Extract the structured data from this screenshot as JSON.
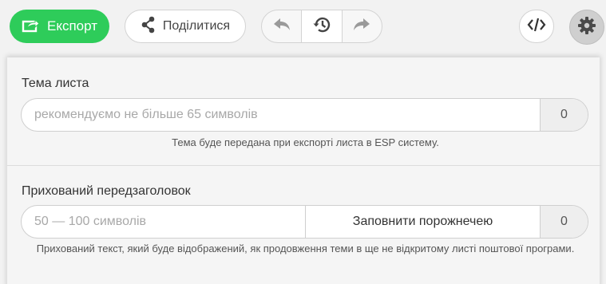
{
  "toolbar": {
    "export_label": "Експорт",
    "share_label": "Поділитися",
    "icons": {
      "export": "export-icon",
      "share": "share-icon",
      "undo": "undo-icon",
      "history": "history-icon",
      "redo": "redo-icon",
      "code": "code-icon",
      "settings": "gear-icon"
    }
  },
  "subject": {
    "label": "Тема листа",
    "placeholder": "рекомендуємо не більше 65 символів",
    "value": "",
    "count": "0",
    "hint": "Тема буде передана при експорті листа в ESP систему."
  },
  "preheader": {
    "label": "Прихований передзаголовок",
    "placeholder": "50 — 100 символів",
    "value": "",
    "fill_button": "Заповнити порожнечею",
    "count": "0",
    "hint": "Прихований текст, який буде відображений, як продовження теми в ще не відкритому листі поштової програми."
  },
  "colors": {
    "accent": "#2ecc5a",
    "background": "#f2f2f2"
  }
}
